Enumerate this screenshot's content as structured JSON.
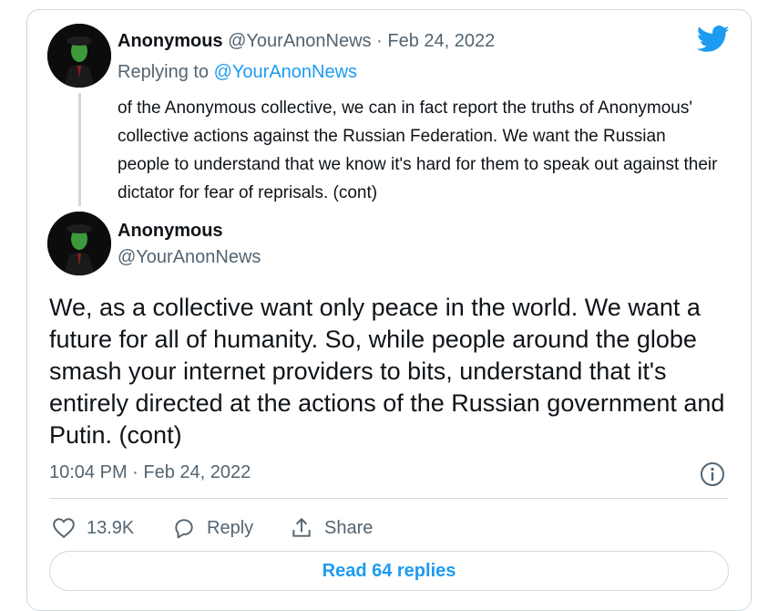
{
  "reply_tweet": {
    "name": "Anonymous",
    "handle": "@YourAnonNews",
    "separator": "·",
    "date": "Feb 24, 2022",
    "replying_prefix": "Replying to",
    "replying_to": "@YourAnonNews",
    "text": "of the Anonymous collective, we can in fact report the truths of Anonymous' collective actions against the Russian Federation.  We want the Russian people to understand that we know it's hard for them to speak out against their dictator for fear of reprisals. (cont)"
  },
  "main_tweet": {
    "name": "Anonymous",
    "handle": "@YourAnonNews",
    "text": "We, as a collective want only peace in the world.  We want a future for all of humanity.  So, while people around the globe smash your internet providers to bits, understand that it's entirely directed at the actions of the Russian government and Putin. (cont)",
    "timestamp": "10:04 PM · Feb 24, 2022"
  },
  "actions": {
    "like_count": "13.9K",
    "reply_label": "Reply",
    "share_label": "Share"
  },
  "read_replies_label": "Read 64 replies",
  "colors": {
    "accent": "#1d9bf0",
    "muted_text": "#536471",
    "border": "#cfd9de"
  },
  "icons": [
    "twitter-bird-icon",
    "info-icon",
    "heart-icon",
    "reply-bubble-icon",
    "share-icon"
  ]
}
